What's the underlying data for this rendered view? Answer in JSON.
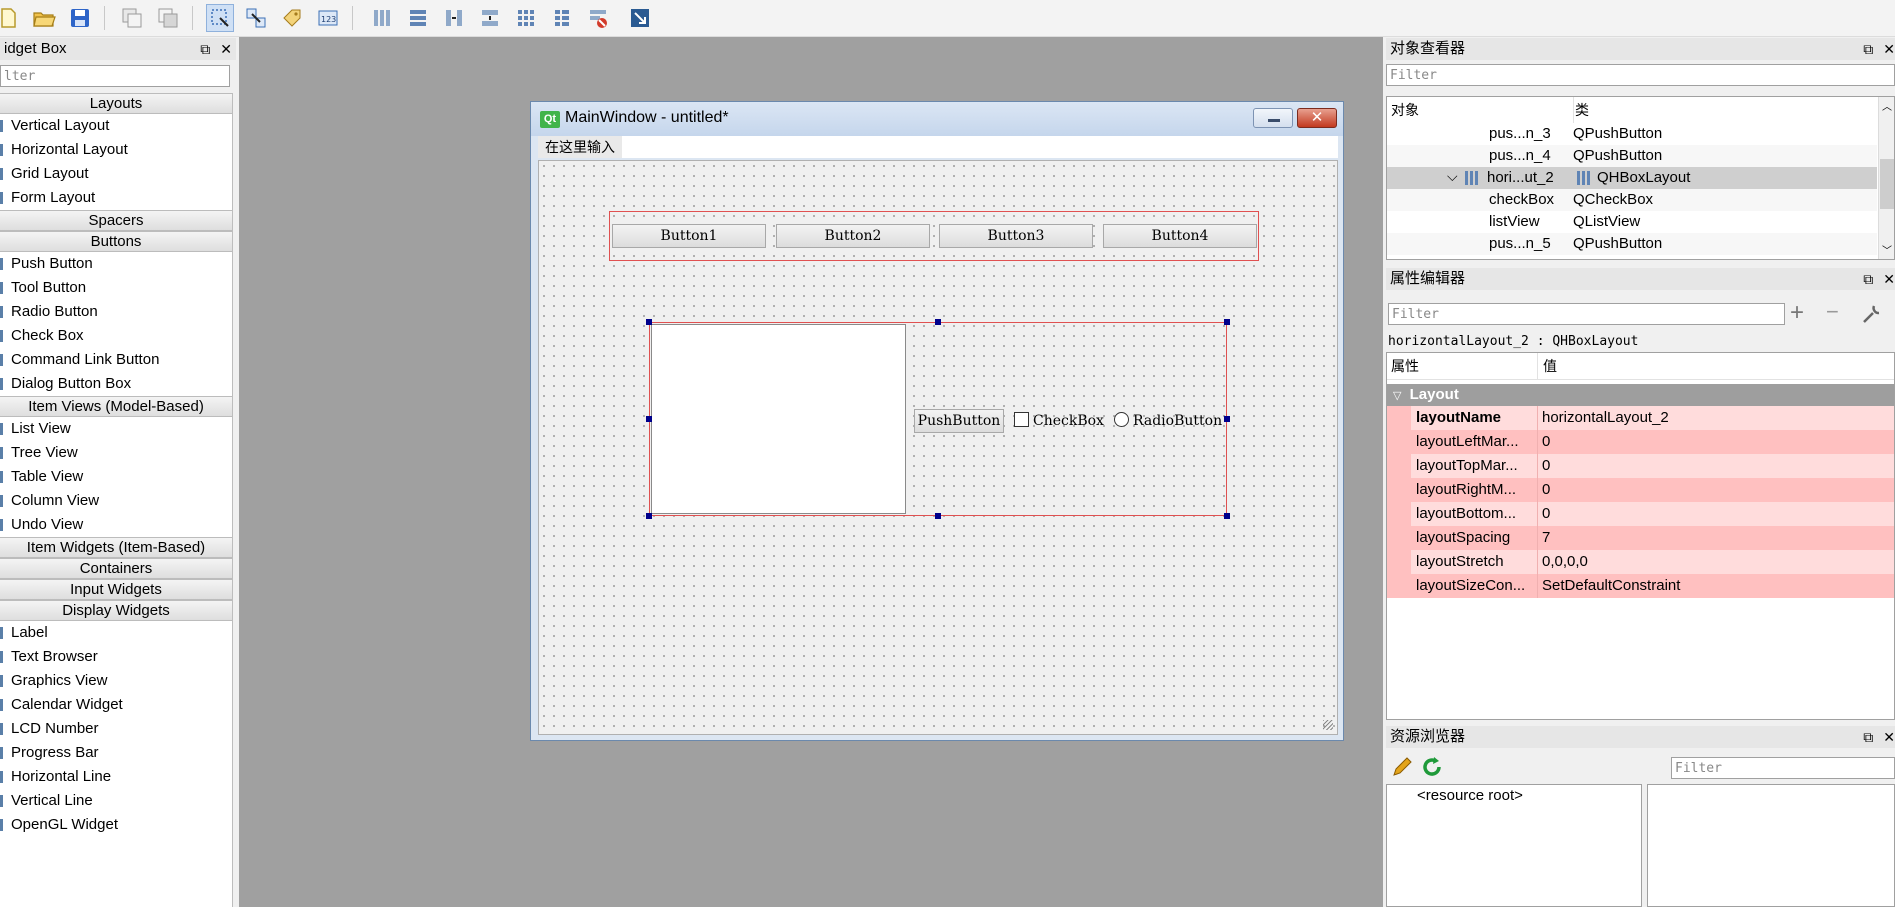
{
  "toolbar": {
    "icons": [
      "new-file-icon",
      "open-folder-icon",
      "save-icon",
      "copy-window-icon",
      "paste-window-icon",
      "edit-widgets-icon",
      "edit-signals-icon",
      "edit-buddies-icon",
      "edit-tab-order-icon",
      "layout-horizontal-icon",
      "layout-vertical-icon",
      "layout-h-splitter-icon",
      "layout-v-splitter-icon",
      "layout-grid-icon",
      "layout-form-icon",
      "break-layout-icon",
      "adjust-size-icon"
    ]
  },
  "widget_box": {
    "title": "idget Box",
    "filter_placeholder": "lter",
    "sections": [
      {
        "label": "Layouts",
        "items": [
          "Vertical Layout",
          "Horizontal Layout",
          "Grid Layout",
          "Form Layout"
        ]
      },
      {
        "label": "Spacers",
        "items": []
      },
      {
        "label": "Buttons",
        "items": [
          "Push Button",
          "Tool Button",
          "Radio Button",
          "Check Box",
          "Command Link Button",
          "Dialog Button Box"
        ]
      },
      {
        "label": "Item Views (Model-Based)",
        "items": [
          "List View",
          "Tree View",
          "Table View",
          "Column View",
          "Undo View"
        ]
      },
      {
        "label": "Item Widgets (Item-Based)",
        "items": []
      },
      {
        "label": "Containers",
        "items": []
      },
      {
        "label": "Input Widgets",
        "items": []
      },
      {
        "label": "Display Widgets",
        "items": [
          "Label",
          "Text Browser",
          "Graphics View",
          "Calendar Widget",
          "LCD Number",
          "Progress Bar",
          "Horizontal Line",
          "Vertical Line",
          "OpenGL Widget"
        ]
      }
    ]
  },
  "main_window": {
    "title": "MainWindow - untitled*",
    "qt_badge": "Qt",
    "menu_placeholder": "在这里输入",
    "buttons": [
      "Button1",
      "Button2",
      "Button3",
      "Button4"
    ],
    "push_button": "PushButton",
    "check_box": "CheckBox",
    "radio_button": "RadioButton"
  },
  "object_inspector": {
    "title": "对象查看器",
    "filter_placeholder": "Filter",
    "col_object": "对象",
    "col_class": "类",
    "rows": [
      {
        "name": "pus...n_3",
        "cls": "QPushButton",
        "selected": false
      },
      {
        "name": "pus...n_4",
        "cls": "QPushButton",
        "selected": false
      },
      {
        "name": "hori...ut_2",
        "cls": "QHBoxLayout",
        "selected": true
      },
      {
        "name": "checkBox",
        "cls": "QCheckBox",
        "selected": false
      },
      {
        "name": "listView",
        "cls": "QListView",
        "selected": false
      },
      {
        "name": "pus...n_5",
        "cls": "QPushButton",
        "selected": false
      }
    ]
  },
  "property_editor": {
    "title": "属性编辑器",
    "filter_placeholder": "Filter",
    "object_label": "horizontalLayout_2 : QHBoxLayout",
    "col_prop": "属性",
    "col_value": "值",
    "group": "Layout",
    "props": [
      {
        "name": "layoutName",
        "value": "horizontalLayout_2"
      },
      {
        "name": "layoutLeftMar...",
        "value": "0"
      },
      {
        "name": "layoutTopMar...",
        "value": "0"
      },
      {
        "name": "layoutRightM...",
        "value": "0"
      },
      {
        "name": "layoutBottom...",
        "value": "0"
      },
      {
        "name": "layoutSpacing",
        "value": "7"
      },
      {
        "name": "layoutStretch",
        "value": "0,0,0,0"
      },
      {
        "name": "layoutSizeCon...",
        "value": "SetDefaultConstraint"
      }
    ]
  },
  "resource_browser": {
    "title": "资源浏览器",
    "filter_placeholder": "Filter",
    "root": "<resource root>"
  },
  "colors": {
    "prop_dark": "#ffc0c0",
    "prop_light": "#ffdcdc",
    "selection": "#cfcfcf",
    "layout_outline": "#e05050"
  }
}
